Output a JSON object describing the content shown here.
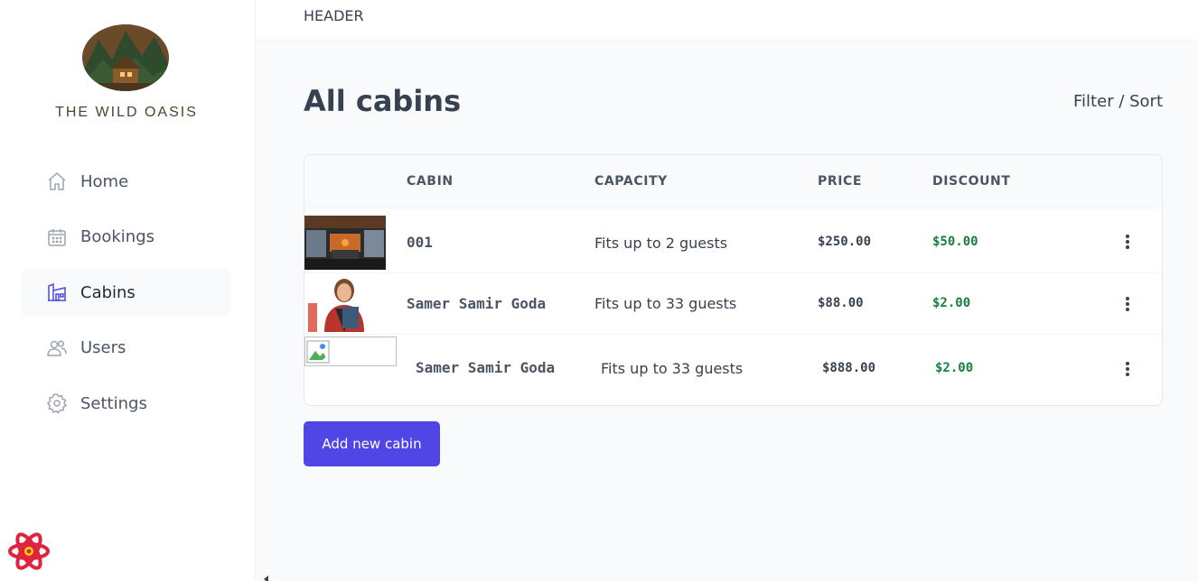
{
  "sidebar": {
    "brand": "THE WILD OASIS",
    "items": [
      {
        "label": "Home",
        "icon": "home-icon"
      },
      {
        "label": "Bookings",
        "icon": "calendar-icon"
      },
      {
        "label": "Cabins",
        "icon": "cabin-icon",
        "active": true
      },
      {
        "label": "Users",
        "icon": "users-icon"
      },
      {
        "label": "Settings",
        "icon": "gear-icon"
      }
    ]
  },
  "header": {
    "text": "HEADER"
  },
  "main": {
    "title": "All cabins",
    "filter_sort": "Filter / Sort",
    "table": {
      "columns": [
        "CABIN",
        "CAPACITY",
        "PRICE",
        "DISCOUNT"
      ],
      "rows": [
        {
          "name": "001",
          "capacity": "Fits up to 2 guests",
          "price": "$250.00",
          "discount": "$50.00"
        },
        {
          "name": "Samer Samir Goda",
          "capacity": "Fits up to 33 guests",
          "price": "$88.00",
          "discount": "$2.00"
        },
        {
          "name": "Samer Samir Goda",
          "capacity": "Fits up to 33 guests",
          "price": "$888.00",
          "discount": "$2.00"
        }
      ]
    },
    "add_button": "Add new cabin"
  },
  "colors": {
    "accent": "#4f46e5",
    "discount": "#15803d",
    "text": "#374151"
  }
}
